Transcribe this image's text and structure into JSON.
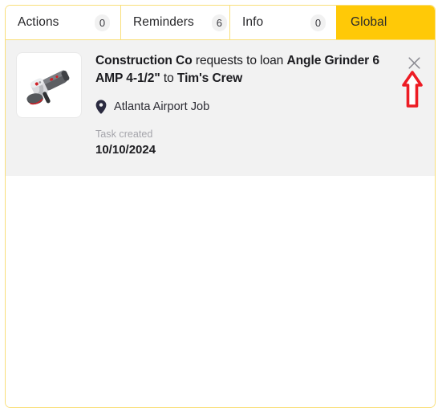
{
  "tabs": [
    {
      "label": "Actions",
      "badge": "0",
      "active": false,
      "name": "tab-actions"
    },
    {
      "label": "Reminders",
      "badge": "6",
      "active": false,
      "name": "tab-reminders"
    },
    {
      "label": "Info",
      "badge": "0",
      "active": false,
      "name": "tab-info"
    },
    {
      "label": "Global",
      "badge": "",
      "active": true,
      "name": "tab-global"
    }
  ],
  "notification": {
    "thumbnail_icon": "angle-grinder-photo",
    "title_parts": [
      {
        "text": "Construction Co",
        "bold": true
      },
      {
        "text": " requests to loan ",
        "bold": false
      },
      {
        "text": "Angle Grinder 6 AMP 4-1/2\"",
        "bold": true
      },
      {
        "text": " to ",
        "bold": false
      },
      {
        "text": "Tim's Crew",
        "bold": true
      }
    ],
    "title_plain": "Construction Co requests to loan Angle Grinder 6 AMP 4-1/2\" to Tim's Crew",
    "location_icon": "map-pin-icon",
    "location": "Atlanta Airport Job",
    "meta_label": "Task created",
    "meta_value": "10/10/2024",
    "close_icon": "close-icon"
  },
  "annotation": {
    "type": "up-arrow",
    "color": "#ed1c24",
    "points_to": "close-icon"
  },
  "colors": {
    "accent_yellow": "#ffc907",
    "border_yellow": "#f9df7b",
    "card_background": "#f2f2f2",
    "badge_background": "#f1f1f1",
    "text_primary": "#1c1c20",
    "text_muted": "#a5a5ab",
    "annotation_red": "#ed1c24"
  }
}
